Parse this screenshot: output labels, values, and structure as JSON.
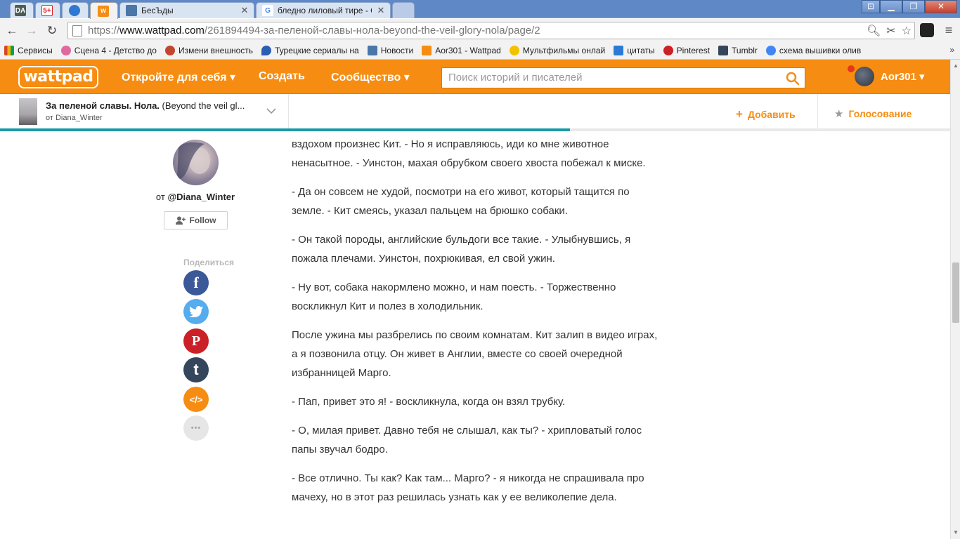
{
  "browser": {
    "tabs": [
      {
        "label": "DA",
        "title": ""
      },
      {
        "label": "5+",
        "title": ""
      },
      {
        "label": "",
        "title": ""
      },
      {
        "label": "w",
        "title": ""
      },
      {
        "label": "",
        "title": "БесЪды"
      },
      {
        "label": "G",
        "title": "бледно лиловый тире - G"
      }
    ],
    "url": {
      "scheme": "https://",
      "host": "www.wattpad.com",
      "path": "/261894494-за-пеленой-славы-нола-beyond-the-veil-glory-nola/page/2"
    },
    "bookmarks": [
      {
        "label": "Сервисы",
        "color": "#d9442c"
      },
      {
        "label": "Сцена 4 - Детство до",
        "color": "#e06aa0"
      },
      {
        "label": "Измени внешность",
        "color": "#c2452f"
      },
      {
        "label": "Турецкие сериалы на",
        "color": "#2a5fb3"
      },
      {
        "label": "Новости",
        "color": "#4a76a8"
      },
      {
        "label": "Aor301 - Wattpad",
        "color": "#f68d12"
      },
      {
        "label": "Мультфильмы онлай",
        "color": "#f2c200"
      },
      {
        "label": "цитаты",
        "color": "#2a7ad6"
      },
      {
        "label": "Pinterest",
        "color": "#cb2027"
      },
      {
        "label": "Tumblr",
        "color": "#35465c"
      },
      {
        "label": "схема вышивки олив",
        "color": "#4285f4"
      }
    ],
    "bookmarks_more": "»"
  },
  "wattpad": {
    "logo": "wattpad",
    "nav": {
      "discover": "Откройте для себя ▾",
      "create": "Создать",
      "community": "Сообщество ▾"
    },
    "search_placeholder": "Поиск историй и писателей",
    "username": "Aor301 ▾",
    "accent_color": "#f68d12"
  },
  "story": {
    "title_bold": "За пеленой славы. Нола.",
    "title_rest": " (Beyond the veil gl...",
    "author_line": "от Diana_Winter",
    "add_label": "Добавить",
    "vote_label": "Голосование",
    "progress_fraction": 0.6
  },
  "author": {
    "prefix": "от ",
    "handle": "@Diana_Winter",
    "follow_label": "Follow"
  },
  "share": {
    "label": "Поделиться",
    "buttons": [
      {
        "icon": "facebook-icon",
        "glyph": "f",
        "color": "#3b5998"
      },
      {
        "icon": "twitter-icon",
        "glyph": "t",
        "color": "#55acee"
      },
      {
        "icon": "pinterest-icon",
        "glyph": "P",
        "color": "#cb2027"
      },
      {
        "icon": "tumblr-icon",
        "glyph": "t",
        "color": "#35465c"
      },
      {
        "icon": "embed-icon",
        "glyph": "</>",
        "color": "#f68d12"
      },
      {
        "icon": "more-icon",
        "glyph": "•••",
        "color": "#e6e6e6"
      }
    ]
  },
  "reading": {
    "paragraphs": [
      "вздохом произнес Кит. - Но я исправляюсь, иди ко мне животное ненасытное. - Уинстон, махая обрубком своего хвоста побежал к миске.",
      "- Да он совсем не худой, посмотри на его живот, который тащится по земле. - Кит смеясь, указал пальцем на брюшко собаки.",
      "- Он такой породы, английские бульдоги все такие. - Улыбнувшись, я пожала плечами. Уинстон, похрюкивая, ел свой ужин.",
      "- Ну вот, собака накормлено можно, и нам поесть. - Торжественно воскликнул Кит и полез в холодильник.",
      "После ужина мы разбрелись по своим комнатам. Кит залип в видео играх, а я позвонила отцу. Он живет в Англии, вместе со своей очередной избранницей Марго.",
      "- Пап, привет это я! - воскликнула, когда он взял трубку.",
      "- О, милая привет. Давно тебя не слышал, как ты? - хрипловатый голос папы звучал бодро.",
      "- Все отлично. Ты как? Как там... Марго? - я никогда не спрашивала про мачеху, но в этот раз решилась узнать как у ее великолепие дела."
    ]
  }
}
